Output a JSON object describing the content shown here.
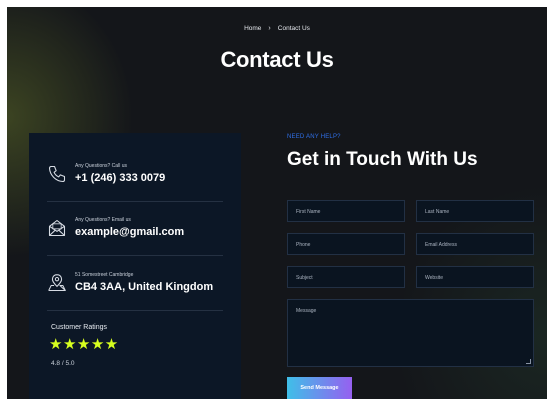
{
  "breadcrumb": {
    "home": "Home",
    "separator": "›",
    "current": "Contact Us"
  },
  "page_title": "Contact Us",
  "contact_info": {
    "phone": {
      "label": "Any Questions? Call us",
      "value": "+1 (246) 333 0079",
      "icon": "phone-icon"
    },
    "email": {
      "label": "Any Questions? Email us",
      "value": "example@gmail.com",
      "icon": "mail-icon"
    },
    "address": {
      "label": "51 Somestreet Cambridge",
      "value": "CB4 3AA, United Kingdom",
      "icon": "map-pin-icon"
    }
  },
  "ratings": {
    "label": "Customer Ratings",
    "stars": "★★★★★",
    "star_count": 5,
    "value": "4.8 / 5.0"
  },
  "form": {
    "eyebrow": "NEED ANY HELP?",
    "title": "Get in Touch With Us",
    "first_name": "First Name",
    "last_name": "Last Name",
    "phone": "Phone",
    "email": "Email Address",
    "subject": "Subject",
    "website": "Website",
    "message": "Message",
    "submit": "Send Message"
  },
  "colors": {
    "background": "#14161a",
    "card": "#0c1726",
    "accent_blue": "#2f6fe8",
    "star": "#d7ff1f",
    "button_gradient_start": "#3fbfe8",
    "button_gradient_end": "#9660f0"
  }
}
